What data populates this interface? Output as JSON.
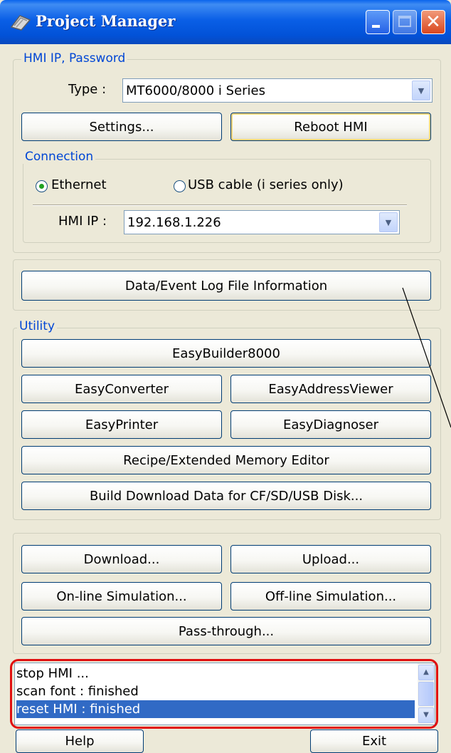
{
  "window": {
    "title": "Project Manager"
  },
  "hmi_group": {
    "legend": "HMI IP, Password",
    "type_label": "Type :",
    "type_value": "MT6000/8000 i Series",
    "settings_button": "Settings...",
    "reboot_button": "Reboot HMI"
  },
  "connection": {
    "legend": "Connection",
    "ethernet_label": "Ethernet",
    "ethernet_selected": true,
    "usb_label": "USB cable (i series only)",
    "ip_label": "HMI IP :",
    "ip_value": "192.168.1.226"
  },
  "log_button": "Data/Event Log File Information",
  "utility": {
    "legend": "Utility",
    "easybuilder": "EasyBuilder8000",
    "easyconverter": "EasyConverter",
    "easyaddressviewer": "EasyAddressViewer",
    "easyprinter": "EasyPrinter",
    "easydiagnoser": "EasyDiagnoser",
    "recipe_editor": "Recipe/Extended Memory Editor",
    "build_download": "Build Download Data for CF/SD/USB Disk..."
  },
  "transfer": {
    "download": "Download...",
    "upload": "Upload...",
    "online_sim": "On-line Simulation...",
    "offline_sim": "Off-line Simulation...",
    "pass_through": "Pass-through..."
  },
  "status_log": {
    "lines": [
      "stop HMI  ...",
      "scan font : finished",
      "reset HMI : finished"
    ],
    "selected_index": 2
  },
  "footer": {
    "help": "Help",
    "exit": "Exit"
  },
  "colors": {
    "title_bar": "#0a5fe6",
    "group_legend": "#0046d5",
    "highlight": "#e01010",
    "selection": "#316ac5"
  }
}
